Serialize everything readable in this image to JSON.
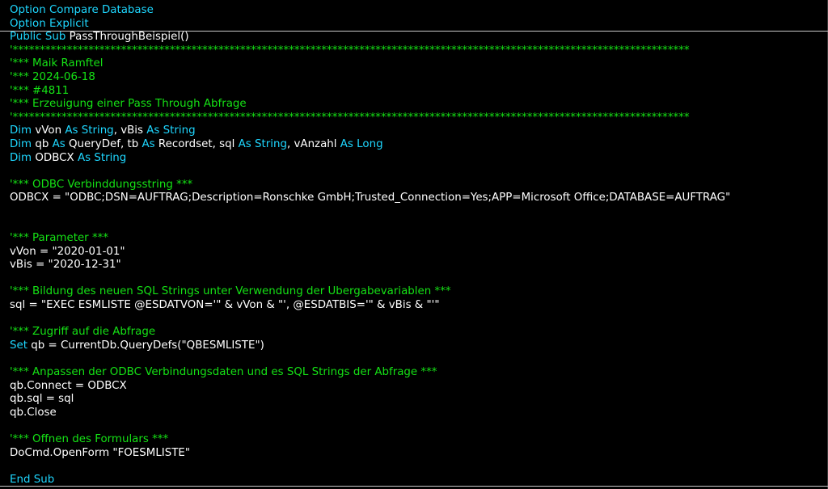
{
  "editor": {
    "colors": {
      "background": "#000000",
      "keyword": "#1ed7ff",
      "comment": "#15e215",
      "text": "#ffffff",
      "separator": "#c8c8c8"
    },
    "lines": [
      [
        {
          "k": "kw",
          "t": "Option Compare Database"
        }
      ],
      [
        {
          "k": "kw",
          "t": "Option Explicit"
        }
      ],
      [
        {
          "k": "kw",
          "t": "Public Sub "
        },
        {
          "k": "tx",
          "t": "PassThroughBeispiel()"
        }
      ],
      [
        {
          "k": "cm",
          "t": "'*****************************************************************************************************************************"
        }
      ],
      [
        {
          "k": "cm",
          "t": "'*** Maik Ramftel"
        }
      ],
      [
        {
          "k": "cm",
          "t": "'*** 2024-06-18"
        }
      ],
      [
        {
          "k": "cm",
          "t": "'*** #4811"
        }
      ],
      [
        {
          "k": "cm",
          "t": "'*** Erzeuigung einer Pass Through Abfrage"
        }
      ],
      [
        {
          "k": "cm",
          "t": "'*****************************************************************************************************************************"
        }
      ],
      [
        {
          "k": "kw",
          "t": "Dim "
        },
        {
          "k": "tx",
          "t": "vVon "
        },
        {
          "k": "kw",
          "t": "As String"
        },
        {
          "k": "tx",
          "t": ", vBis "
        },
        {
          "k": "kw",
          "t": "As String"
        }
      ],
      [
        {
          "k": "kw",
          "t": "Dim "
        },
        {
          "k": "tx",
          "t": "qb "
        },
        {
          "k": "kw",
          "t": "As "
        },
        {
          "k": "tx",
          "t": "QueryDef, tb "
        },
        {
          "k": "kw",
          "t": "As "
        },
        {
          "k": "tx",
          "t": "Recordset, sql "
        },
        {
          "k": "kw",
          "t": "As String"
        },
        {
          "k": "tx",
          "t": ", vAnzahl "
        },
        {
          "k": "kw",
          "t": "As Long"
        }
      ],
      [
        {
          "k": "kw",
          "t": "Dim "
        },
        {
          "k": "tx",
          "t": "ODBCX "
        },
        {
          "k": "kw",
          "t": "As String"
        }
      ],
      [],
      [
        {
          "k": "cm",
          "t": "'*** ODBC Verbinddungsstring ***"
        }
      ],
      [
        {
          "k": "tx",
          "t": "ODBCX = \"ODBC;DSN=AUFTRAG;Description=Ronschke GmbH;Trusted_Connection=Yes;APP=Microsoft Office;DATABASE=AUFTRAG\""
        }
      ],
      [],
      [],
      [
        {
          "k": "cm",
          "t": "'*** Parameter ***"
        }
      ],
      [
        {
          "k": "tx",
          "t": "vVon = \"2020-01-01\""
        }
      ],
      [
        {
          "k": "tx",
          "t": "vBis = \"2020-12-31\""
        }
      ],
      [],
      [
        {
          "k": "cm",
          "t": "'*** Bildung des neuen SQL Strings unter Verwendung der Übergabevariablen ***"
        }
      ],
      [
        {
          "k": "tx",
          "t": "sql = \"EXEC ESMLISTE @ESDATVON='\" & vVon & \"', @ESDATBIS='\" & vBis & \"'\""
        }
      ],
      [],
      [
        {
          "k": "cm",
          "t": "'*** Zugriff auf die Abfrage"
        }
      ],
      [
        {
          "k": "kw",
          "t": "Set "
        },
        {
          "k": "tx",
          "t": "qb = CurrentDb.QueryDefs(\"QBESMLISTE\")"
        }
      ],
      [],
      [
        {
          "k": "cm",
          "t": "'*** Anpassen der ODBC Verbindungsdaten und es SQL Strings der Abfrage ***"
        }
      ],
      [
        {
          "k": "tx",
          "t": "qb.Connect = ODBCX"
        }
      ],
      [
        {
          "k": "tx",
          "t": "qb.sql = sql"
        }
      ],
      [
        {
          "k": "tx",
          "t": "qb.Close"
        }
      ],
      [],
      [
        {
          "k": "cm",
          "t": "'*** Öffnen des Formulars ***"
        }
      ],
      [
        {
          "k": "tx",
          "t": "DoCmd.OpenForm \"FOESMLISTE\""
        }
      ],
      [],
      [
        {
          "k": "kw",
          "t": "End Sub"
        }
      ]
    ]
  }
}
